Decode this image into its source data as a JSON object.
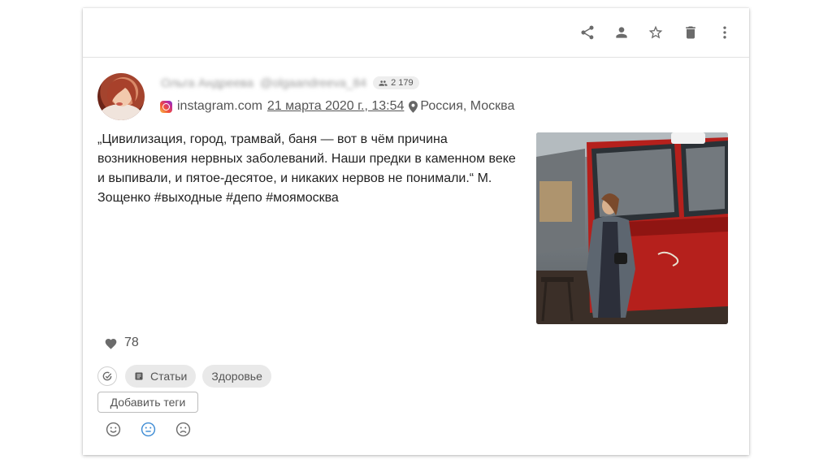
{
  "toolbar": {
    "icons": [
      "share-icon",
      "person-icon",
      "star-icon",
      "trash-icon",
      "more-vert-icon"
    ]
  },
  "author": {
    "name": "Ольга Андреева",
    "handle": "@olgaandreeva_84",
    "followers": "2 179"
  },
  "source": {
    "platform": "instagram.com",
    "date": "21 марта 2020 г., 13:54",
    "location": "Россия, Москва"
  },
  "post": {
    "text": "„Цивилизация, город, трамвай, баня — вот в чём причина возникновения нервных заболеваний. Наши предки в каменном веке и выпивали, и пятое-десятое, и никаких нервов не понимали.“ М. Зощенко #выходные #депо #моямосква"
  },
  "likes": {
    "count": "78"
  },
  "tags": {
    "items": [
      "Статьи",
      "Здоровье"
    ],
    "add_label": "Добавить теги"
  },
  "sentiment": {
    "options": [
      "positive",
      "neutral",
      "negative"
    ],
    "selected": "neutral"
  },
  "colors": {
    "icon_gray": "#6b6b6b",
    "selected_blue": "#3d8bd4",
    "chip_bg": "#e9e9e9",
    "tram_red": "#b5201c"
  }
}
